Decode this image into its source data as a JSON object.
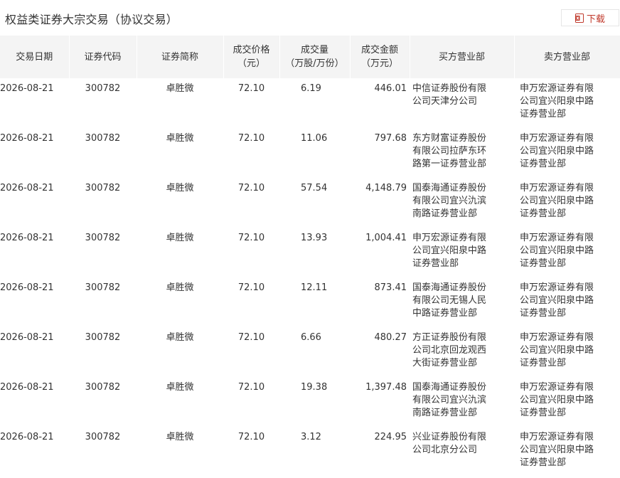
{
  "page": {
    "title": "权益类证券大宗交易（协议交易）",
    "download_label": "下载"
  },
  "table": {
    "headers": [
      [
        "交易日期"
      ],
      [
        "证券代码"
      ],
      [
        "证券简称"
      ],
      [
        "成交价格",
        "（元）"
      ],
      [
        "成交量",
        "（万股/万份）"
      ],
      [
        "成交金额",
        "（万元）"
      ],
      [
        "买方营业部"
      ],
      [
        "卖方营业部"
      ]
    ],
    "rows": [
      {
        "date": "2026-08-21",
        "code": "300782",
        "name": "卓胜微",
        "price": "72.10",
        "volume": "6.19",
        "amount": "446.01",
        "buyer": "中信证券股份有限公司天津分公司",
        "seller": "申万宏源证券有限公司宜兴阳泉中路证券营业部"
      },
      {
        "date": "2026-08-21",
        "code": "300782",
        "name": "卓胜微",
        "price": "72.10",
        "volume": "11.06",
        "amount": "797.68",
        "buyer": "东方财富证券股份有限公司拉萨东环路第一证券营业部",
        "seller": "申万宏源证券有限公司宜兴阳泉中路证券营业部"
      },
      {
        "date": "2026-08-21",
        "code": "300782",
        "name": "卓胜微",
        "price": "72.10",
        "volume": "57.54",
        "amount": "4,148.79",
        "buyer": "国泰海通证券股份有限公司宜兴氿滨南路证券营业部",
        "seller": "申万宏源证券有限公司宜兴阳泉中路证券营业部"
      },
      {
        "date": "2026-08-21",
        "code": "300782",
        "name": "卓胜微",
        "price": "72.10",
        "volume": "13.93",
        "amount": "1,004.41",
        "buyer": "申万宏源证券有限公司宜兴阳泉中路证券营业部",
        "seller": "申万宏源证券有限公司宜兴阳泉中路证券营业部"
      },
      {
        "date": "2026-08-21",
        "code": "300782",
        "name": "卓胜微",
        "price": "72.10",
        "volume": "12.11",
        "amount": "873.41",
        "buyer": "国泰海通证券股份有限公司无锡人民中路证券营业部",
        "seller": "申万宏源证券有限公司宜兴阳泉中路证券营业部"
      },
      {
        "date": "2026-08-21",
        "code": "300782",
        "name": "卓胜微",
        "price": "72.10",
        "volume": "6.66",
        "amount": "480.27",
        "buyer": "方正证券股份有限公司北京回龙观西大街证券营业部",
        "seller": "申万宏源证券有限公司宜兴阳泉中路证券营业部"
      },
      {
        "date": "2026-08-21",
        "code": "300782",
        "name": "卓胜微",
        "price": "72.10",
        "volume": "19.38",
        "amount": "1,397.48",
        "buyer": "国泰海通证券股份有限公司宜兴氿滨南路证券营业部",
        "seller": "申万宏源证券有限公司宜兴阳泉中路证券营业部"
      },
      {
        "date": "2026-08-21",
        "code": "300782",
        "name": "卓胜微",
        "price": "72.10",
        "volume": "3.12",
        "amount": "224.95",
        "buyer": "兴业证券股份有限公司北京分公司",
        "seller": "申万宏源证券有限公司宜兴阳泉中路证券营业部"
      }
    ]
  },
  "colors": {
    "accent": "#c0392b",
    "header_bg": "#f4f4f4",
    "text": "#333333"
  },
  "icons": {
    "download": "excel-file-icon"
  }
}
